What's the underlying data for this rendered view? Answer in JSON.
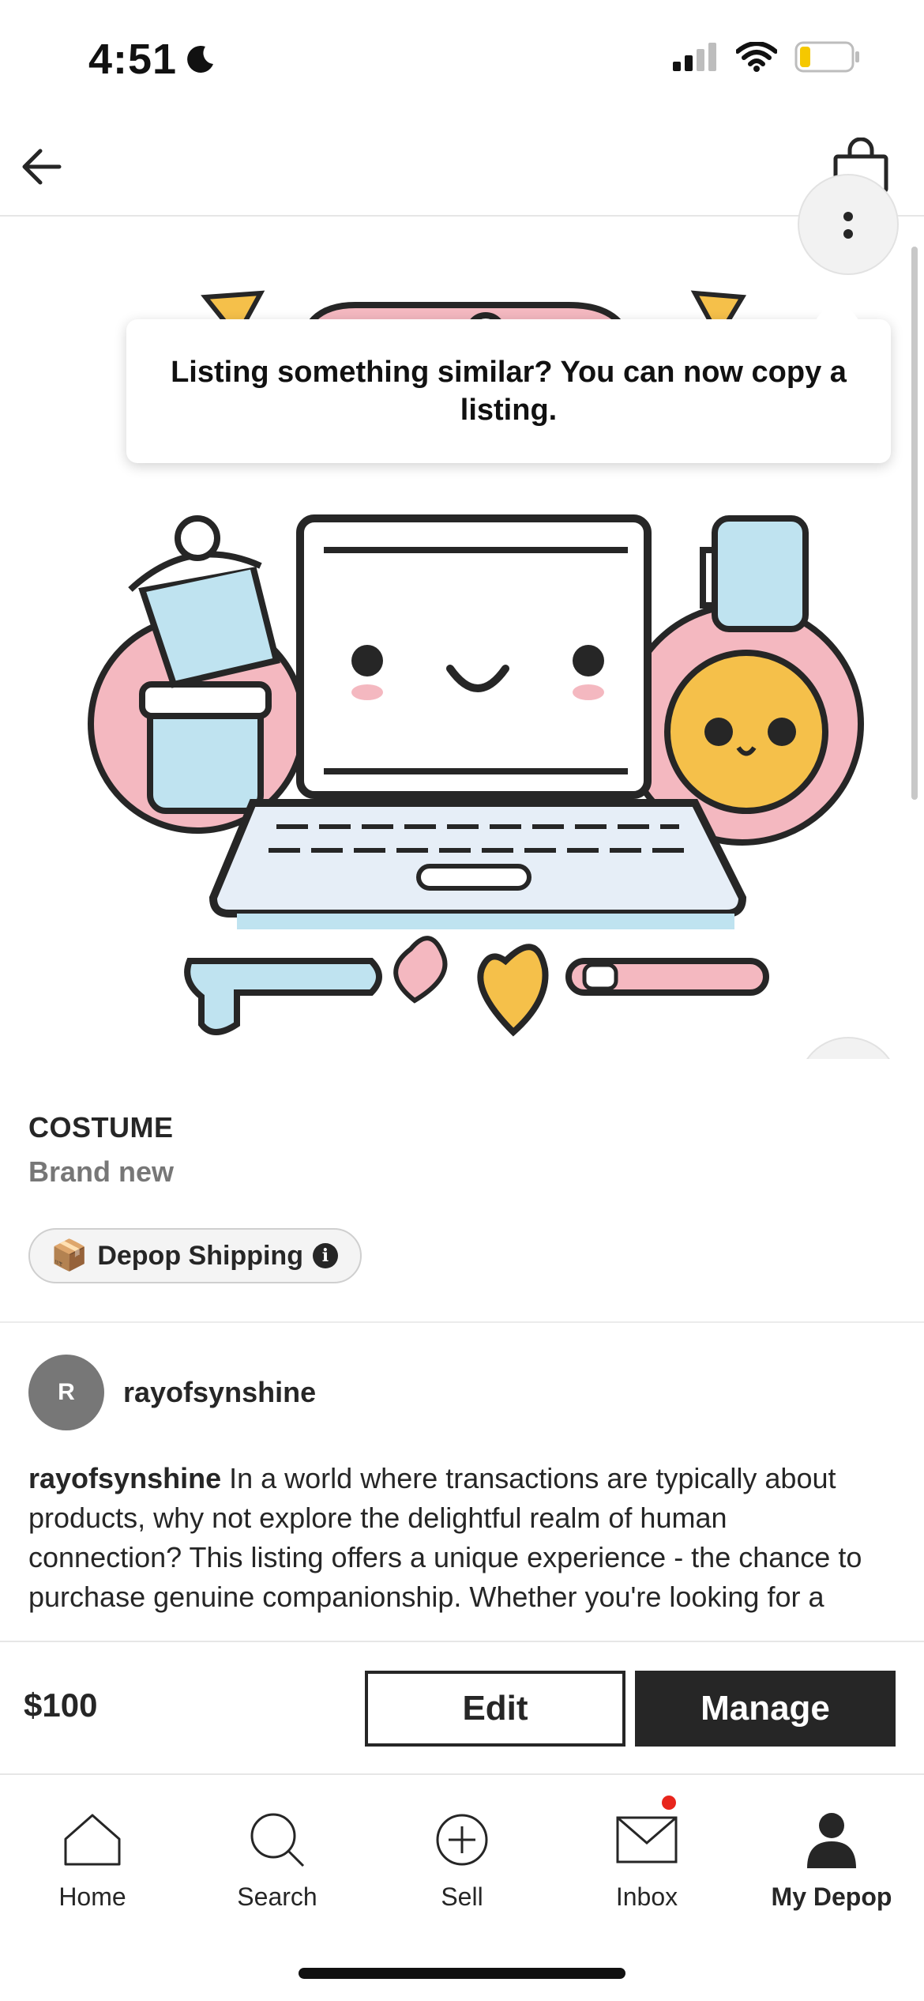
{
  "status_bar": {
    "time": "4:51"
  },
  "header": {
    "back_icon": "arrow-left-icon",
    "bag_icon": "shopping-bag-icon"
  },
  "tooltip": {
    "text": "Listing something similar? You can now copy a listing."
  },
  "product": {
    "title": "COSTUME",
    "condition": "Brand new",
    "shipping_emoji": "📦",
    "shipping_label": "Depop Shipping"
  },
  "seller": {
    "initial": "R",
    "username": "rayofsynshine"
  },
  "description": {
    "username": "rayofsynshine",
    "text": "In a world where transactions are typically about products, why not explore the delightful realm of human connection? This listing offers a unique experience - the chance to purchase genuine companionship. Whether you're looking for a"
  },
  "action_bar": {
    "price": "$100",
    "edit_label": "Edit",
    "manage_label": "Manage"
  },
  "nav": {
    "items": [
      {
        "label": "Home",
        "icon": "home-icon"
      },
      {
        "label": "Search",
        "icon": "search-icon"
      },
      {
        "label": "Sell",
        "icon": "plus-circle-icon"
      },
      {
        "label": "Inbox",
        "icon": "mail-icon"
      },
      {
        "label": "My Depop",
        "icon": "person-icon"
      }
    ]
  },
  "colors": {
    "text": "#262626",
    "muted": "#777777",
    "notification": "#e8251c",
    "pink": "#f4b8c0",
    "light_blue": "#bfe3f0",
    "yellow": "#f5c04a"
  }
}
